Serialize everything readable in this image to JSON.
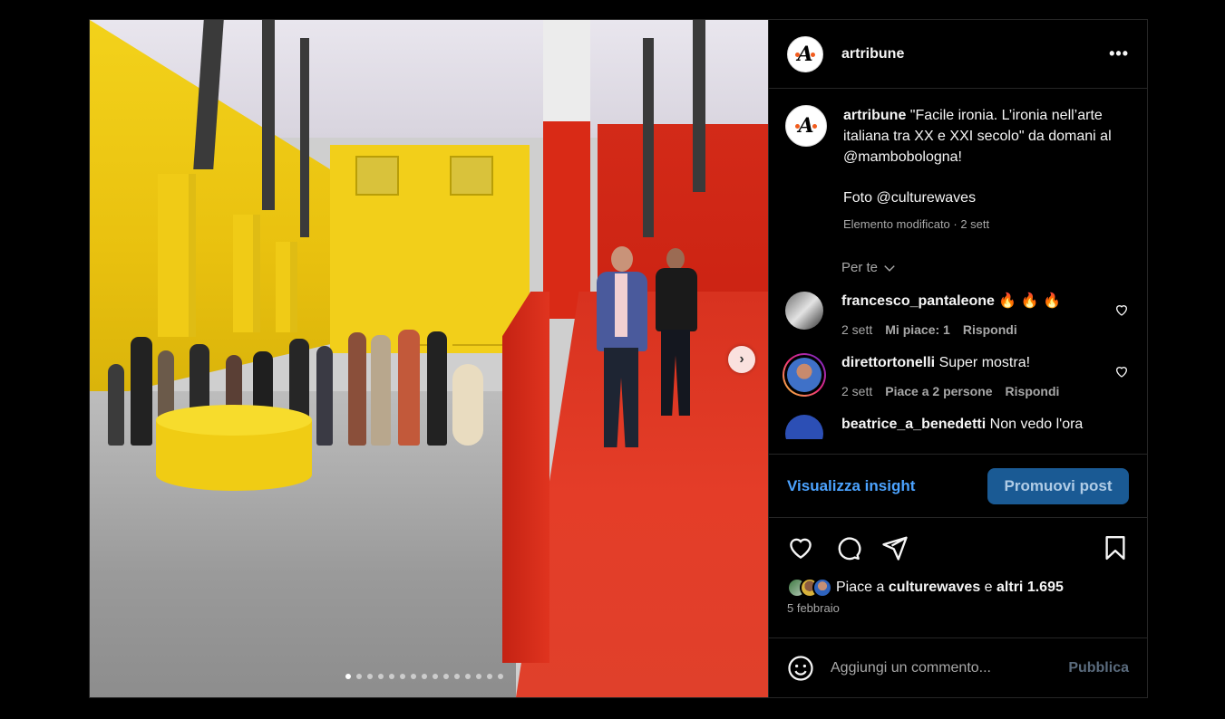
{
  "post": {
    "username": "artribune",
    "more_label": "•••",
    "photo_alt": "Sala espositiva con pareti gialle e passerella rossa",
    "carousel": {
      "current": 1,
      "count": 15
    }
  },
  "caption": {
    "username": "artribune",
    "text": "\"Facile ironia. L’ironia nell’arte italiana tra XX e XXI secolo\" da domani al @mambobologna!",
    "credit": "Foto @culturewaves",
    "meta": "Elemento modificato · 2 sett"
  },
  "per_te": "Per te",
  "comments": [
    {
      "username": "francesco_pantaleone",
      "text": "🔥 🔥 🔥",
      "time": "2 sett",
      "likes": "Mi piace: 1",
      "reply": "Rispondi"
    },
    {
      "username": "direttortonelli",
      "text": "Super mostra!",
      "time": "2 sett",
      "likes": "Piace a 2 persone",
      "reply": "Rispondi"
    },
    {
      "username": "beatrice_a_benedetti",
      "text": "Non vedo l'ora"
    }
  ],
  "promo": {
    "insight": "Visualizza insight",
    "promote": "Promuovi post"
  },
  "likes": {
    "prefix": "Piace a",
    "user": "culturewaves",
    "joiner": "e",
    "others": "altri 1.695"
  },
  "date": "5 febbraio",
  "composer": {
    "placeholder": "Aggiungi un commento...",
    "submit": "Pubblica"
  },
  "colors": {
    "accent": "#4ca3ff",
    "promote_bg": "#1a5a94",
    "muted": "#a8a8a8"
  },
  "icons": [
    "more-icon",
    "heart-icon",
    "comment-icon",
    "share-icon",
    "bookmark-icon",
    "emoji-icon",
    "chevron-down-icon",
    "chevron-right-icon"
  ]
}
